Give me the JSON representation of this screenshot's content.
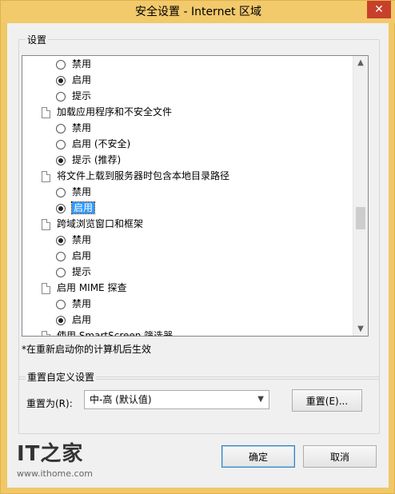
{
  "window": {
    "title": "安全设置 - Internet 区域",
    "close_glyph": "✕"
  },
  "settings": {
    "legend": "设置",
    "items": [
      {
        "type": "option",
        "label": "禁用",
        "checked": false
      },
      {
        "type": "option",
        "label": "启用",
        "checked": true
      },
      {
        "type": "option",
        "label": "提示",
        "checked": false
      },
      {
        "type": "heading",
        "label": "加载应用程序和不安全文件"
      },
      {
        "type": "option",
        "label": "禁用",
        "checked": false
      },
      {
        "type": "option",
        "label": "启用 (不安全)",
        "checked": false
      },
      {
        "type": "option",
        "label": "提示 (推荐)",
        "checked": true
      },
      {
        "type": "heading",
        "label": "将文件上载到服务器时包含本地目录路径"
      },
      {
        "type": "option",
        "label": "禁用",
        "checked": false
      },
      {
        "type": "option",
        "label": "启用",
        "checked": true,
        "selected": true
      },
      {
        "type": "heading",
        "label": "跨域浏览窗口和框架"
      },
      {
        "type": "option",
        "label": "禁用",
        "checked": true
      },
      {
        "type": "option",
        "label": "启用",
        "checked": false
      },
      {
        "type": "option",
        "label": "提示",
        "checked": false
      },
      {
        "type": "heading",
        "label": "启用 MIME 探查"
      },
      {
        "type": "option",
        "label": "禁用",
        "checked": false
      },
      {
        "type": "option",
        "label": "启用",
        "checked": true
      },
      {
        "type": "heading",
        "label": "使用 SmartScreen 筛选器"
      }
    ],
    "scroll_position": 0.55,
    "footnote": "*在重新启动你的计算机后生效"
  },
  "reset": {
    "legend": "重置自定义设置",
    "reset_to_label": "重置为(R):",
    "selected_level": "中-高 (默认值)",
    "reset_button": "重置(E)..."
  },
  "buttons": {
    "ok": "确定",
    "cancel": "取消"
  },
  "watermark": {
    "logo": "IT之家",
    "url": "www.ithome.com"
  },
  "colors": {
    "title_bar": "#f2c96b",
    "selection": "#3399ff",
    "close_button": "#c7402c"
  },
  "icons": {
    "item": "document-icon",
    "option": "radio-icon",
    "dropdown": "chevron-down-icon"
  }
}
